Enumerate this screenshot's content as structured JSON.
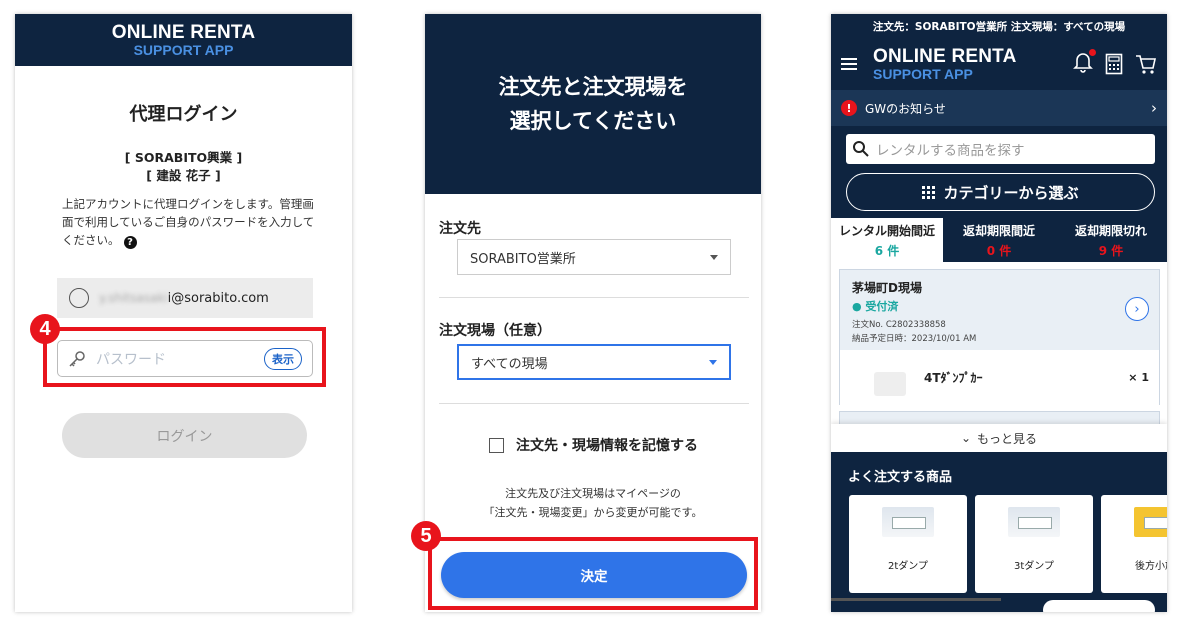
{
  "login_panel": {
    "app_title": "ONLINE RENTA",
    "app_subtitle": "SUPPORT APP",
    "title": "代理ログイン",
    "company": "[ SORABITO興業 ]",
    "user": "[ 建設 花子 ]",
    "description": "上記アカウントに代理ログインをします。管理画面で利用しているご自身のパスワードを入力してください。",
    "help_icon": "question-circle-icon",
    "email_blurred": "y.shitsasaki",
    "email_domain": "i@sorabito.com",
    "step_number": "4",
    "password_placeholder": "パスワード",
    "show_label": "表示",
    "login_label": "ログイン"
  },
  "select_panel": {
    "heading_line1": "注文先と注文現場を",
    "heading_line2": "選択してください",
    "order_to_label": "注文先",
    "order_to_value": "SORABITO営業所",
    "site_label": "注文現場（任意）",
    "site_value": "すべての現場",
    "remember_label": "注文先・現場情報を記憶する",
    "note_line1": "注文先及び注文現場はマイページの",
    "note_line2": "「注文先・現場変更」から変更が可能です。",
    "step_number": "5",
    "decide_label": "決定"
  },
  "home_panel": {
    "top_context": "注文先：SORABITO営業所 注文現場：すべての現場",
    "app_title": "ONLINE RENTA",
    "app_subtitle": "SUPPORT APP",
    "notice": "GWのお知らせ",
    "search_placeholder": "レンタルする商品を探す",
    "category_label": "カテゴリーから選ぶ",
    "tabs": [
      {
        "label": "レンタル開始間近",
        "count": "6 件"
      },
      {
        "label": "返却期限間近",
        "count": "0 件"
      },
      {
        "label": "返却期限切れ",
        "count": "9 件"
      }
    ],
    "order": {
      "site": "茅場町D現場",
      "status": "● 受付済",
      "order_no": "注文No. C2802338858",
      "delivery": "納品予定日時：2023/10/01  AM",
      "item": "4Tﾀﾞﾝﾌﾟｶｰ",
      "qty": "× 1"
    },
    "more_label": "もっと見る",
    "fav_title": "よく注文する商品",
    "products": [
      "2tダンプ",
      "3tダンプ",
      "後方小旋回"
    ],
    "colors": {
      "navy": "#0e2440",
      "accent_blue": "#2f74e8",
      "red": "#e8141c",
      "teal": "#1aa7a0"
    }
  }
}
